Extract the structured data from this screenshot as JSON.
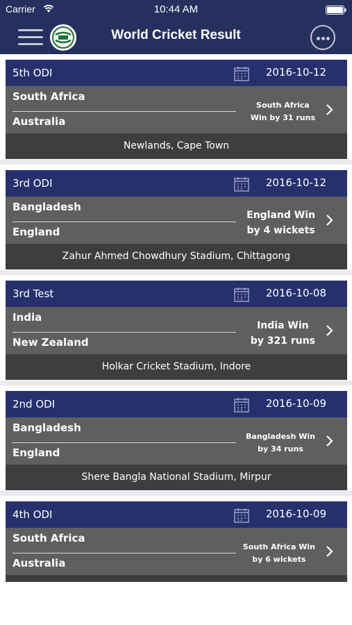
{
  "status_bar": {
    "carrier": "Carrier",
    "time": "10:44 AM"
  },
  "nav": {
    "title": "World Cricket Result",
    "logo_icon": "cricket-logo-icon",
    "menu_icon": "hamburger-menu-icon",
    "more_icon": "more-options-icon"
  },
  "colors": {
    "nav_background": "#26305f",
    "card_header": "#26306c",
    "card_body": "#5f5f5f",
    "card_footer": "#3e3e3e"
  },
  "matches": [
    {
      "match_type": "5th ODI",
      "date": "2016-10-12",
      "team_a": "South Africa",
      "team_b": "Australia",
      "result_line1": "South Africa",
      "result_line2": "Win by 31 runs",
      "venue": "Newlands, Cape Town"
    },
    {
      "match_type": "3rd ODI",
      "date": "2016-10-12",
      "team_a": "Bangladesh",
      "team_b": "England",
      "result_line1": "England Win",
      "result_line2": "by 4 wickets",
      "venue": "Zahur Ahmed Chowdhury Stadium, Chittagong"
    },
    {
      "match_type": "3rd Test",
      "date": "2016-10-08",
      "team_a": "India",
      "team_b": "New Zealand",
      "result_line1": "India Win",
      "result_line2": "by 321 runs",
      "venue": "Holkar Cricket Stadium, Indore"
    },
    {
      "match_type": "2nd ODI",
      "date": "2016-10-09",
      "team_a": "Bangladesh",
      "team_b": "England",
      "result_line1": "Bangladesh Win",
      "result_line2": "by 34 runs",
      "venue": "Shere Bangla National Stadium, Mirpur"
    },
    {
      "match_type": "4th ODI",
      "date": "2016-10-09",
      "team_a": "South Africa",
      "team_b": "Australia",
      "result_line1": "South Africa Win",
      "result_line2": "by 6 wickets",
      "venue": ""
    }
  ]
}
